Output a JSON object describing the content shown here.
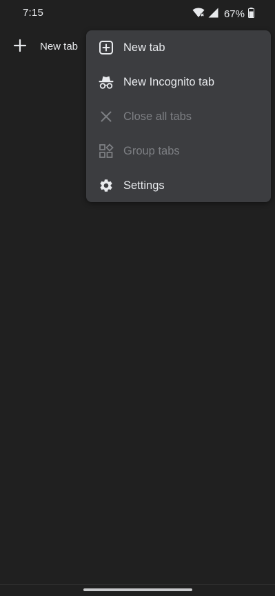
{
  "status_bar": {
    "time": "7:15",
    "battery_percent": "67%",
    "icons": [
      "wifi-icon",
      "signal-icon",
      "battery-icon"
    ]
  },
  "toolbar": {
    "new_tab_label": "New tab",
    "add_icon": "plus-icon"
  },
  "menu": {
    "items": [
      {
        "label": "New tab",
        "icon": "new-tab-icon",
        "enabled": true
      },
      {
        "label": "New Incognito tab",
        "icon": "incognito-icon",
        "enabled": true
      },
      {
        "label": "Close all tabs",
        "icon": "close-icon",
        "enabled": false
      },
      {
        "label": "Group tabs",
        "icon": "group-tabs-icon",
        "enabled": false
      },
      {
        "label": "Settings",
        "icon": "gear-icon",
        "enabled": true
      }
    ]
  },
  "colors": {
    "background": "#202020",
    "menu_background": "#3c3d40",
    "text": "#e8eaed",
    "disabled_text": "#7d7f83"
  }
}
